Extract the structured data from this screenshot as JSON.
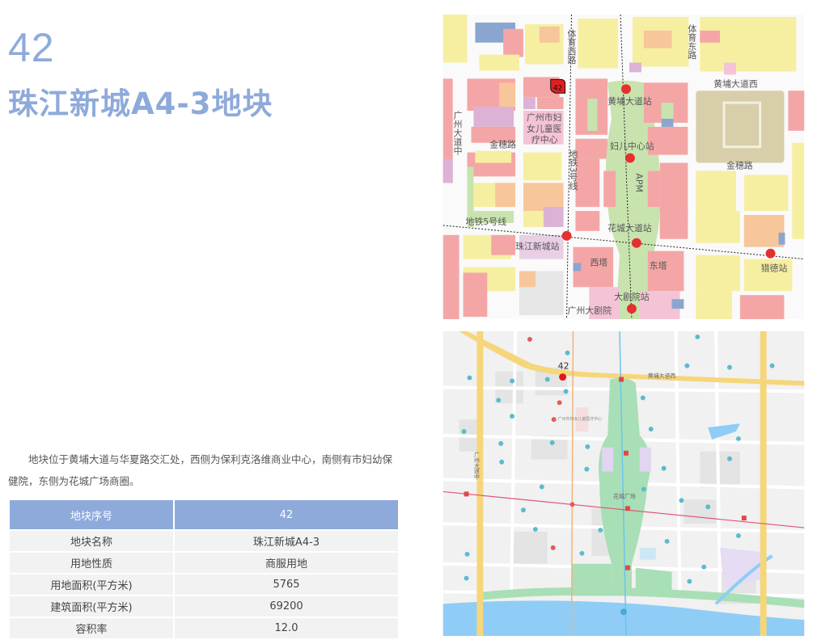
{
  "plot": {
    "number": "42",
    "title": "珠江新城A4-3地块",
    "description": "地块位于黄埔大道与华夏路交汇处，西侧为保利克洛维商业中心，南侧有市妇幼保健院，东侧为花城广场商圈。"
  },
  "table": {
    "header": {
      "label": "地块序号",
      "value": "42"
    },
    "rows": [
      {
        "label": "地块名称",
        "value": "珠江新城A4-3"
      },
      {
        "label": "用地性质",
        "value": "商服用地"
      },
      {
        "label": "用地面积(平方米)",
        "value": "5765"
      },
      {
        "label": "建筑面积(平方米)",
        "value": "69200"
      },
      {
        "label": "容积率",
        "value": "12.0"
      }
    ]
  },
  "planning_map": {
    "marker": "42",
    "labels": {
      "tiyu_xi": "体育西路",
      "tiyu_dong": "体育东路",
      "huangpu_west": "黄埔大道西",
      "hospital": "广州市妇女儿童医疗中心",
      "guangzhou_ave": "广州大道中",
      "jinsui_w": "金穗路",
      "jinsui_e": "金穗路",
      "metro3": "地铁3号线",
      "apm": "APM",
      "metro5": "地铁5号线",
      "xita": "西塔",
      "dongta": "东塔",
      "opera": "广州大剧院"
    },
    "stations": [
      "黄埔大道站",
      "妇儿中心站",
      "花城大道站",
      "珠江新城站",
      "猎德站",
      "大剧院站"
    ]
  },
  "street_map": {
    "marker": "42",
    "labels": {
      "road1": "黄埔大道西",
      "road2": "广州大道中",
      "square": "花城广场",
      "hospital": "广州市妇女儿童医疗中心"
    }
  },
  "colors": {
    "accent": "#8eaadb",
    "commercial": "#f4a6a6",
    "residential": "#f6efa2",
    "green": "#c8e3ae",
    "metro": "#d92b2b"
  }
}
